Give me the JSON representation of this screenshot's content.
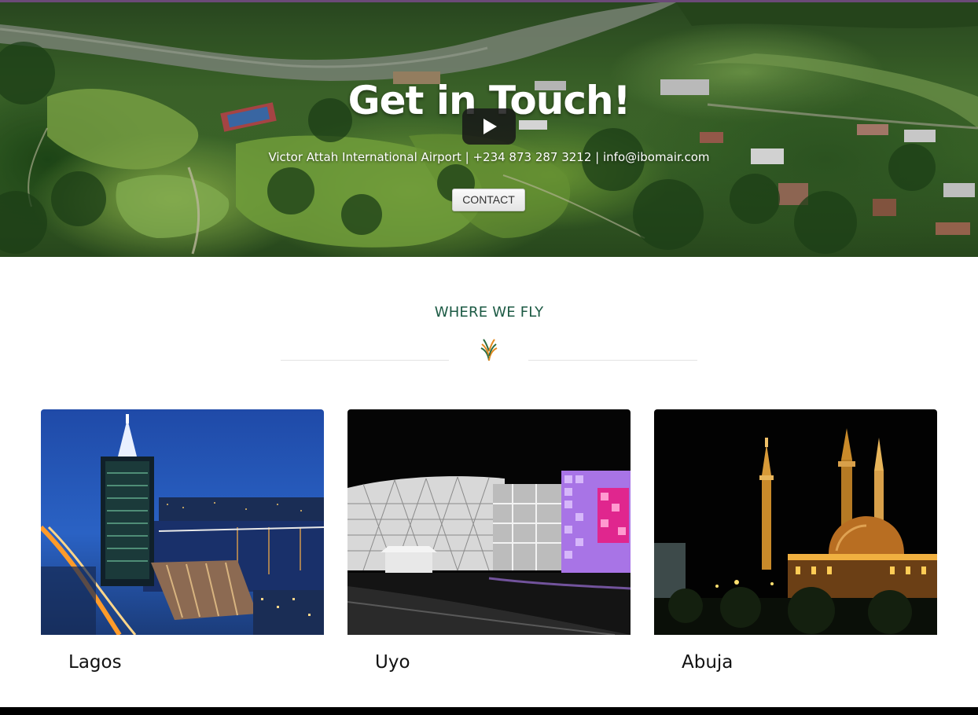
{
  "hero": {
    "title": "Get in Touch!",
    "info": "Victor Attah International Airport | +234 873 287 3212 | info@ibomair.com",
    "contact_label": "CONTACT",
    "play_icon": "play-icon"
  },
  "destinations": {
    "heading": "WHERE WE FLY",
    "divider_icon": "leaf-icon",
    "items": [
      {
        "city": "Lagos"
      },
      {
        "city": "Uyo"
      },
      {
        "city": "Abuja"
      }
    ]
  },
  "colors": {
    "heading": "#1c5a44",
    "accent_orange": "#e58a1f",
    "accent_green": "#2b6b3f"
  }
}
